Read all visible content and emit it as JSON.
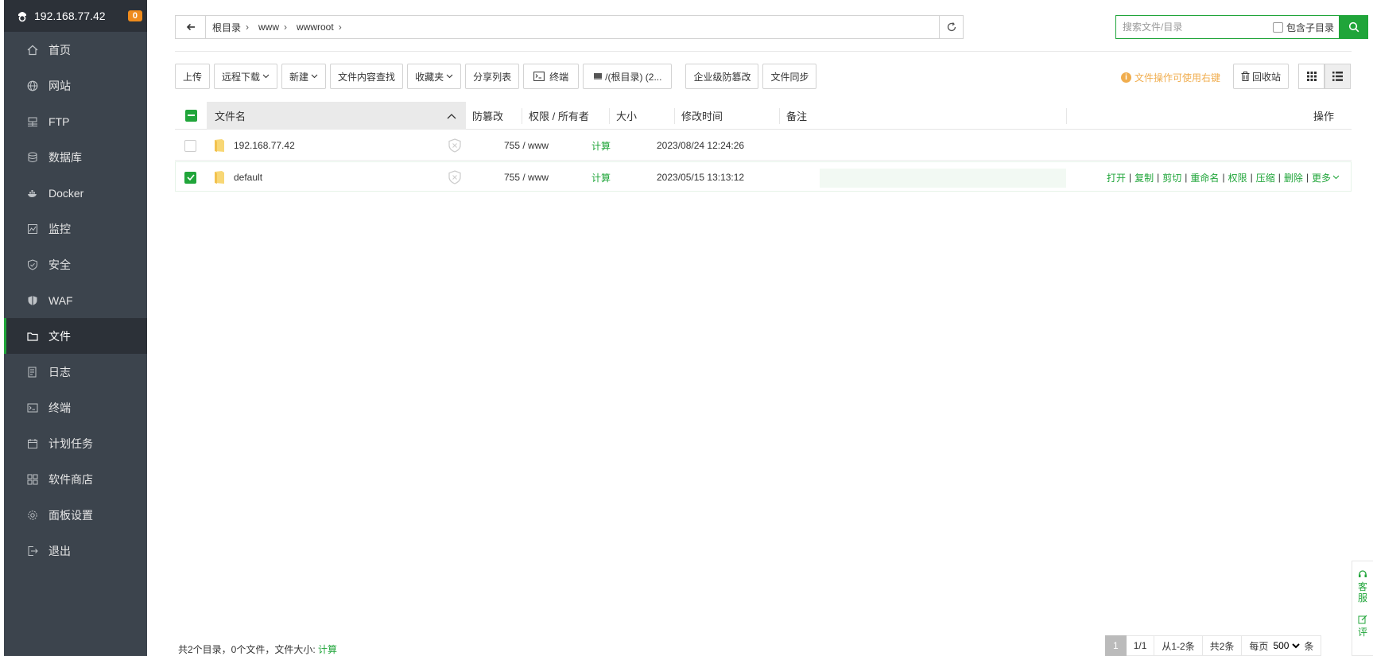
{
  "sidebar": {
    "host": "192.168.77.42",
    "badge": "0",
    "items": [
      {
        "label": "首页",
        "icon": "home-icon"
      },
      {
        "label": "网站",
        "icon": "globe-icon"
      },
      {
        "label": "FTP",
        "icon": "ftp-icon"
      },
      {
        "label": "数据库",
        "icon": "database-icon"
      },
      {
        "label": "Docker",
        "icon": "docker-icon"
      },
      {
        "label": "监控",
        "icon": "monitor-icon"
      },
      {
        "label": "安全",
        "icon": "shield-icon"
      },
      {
        "label": "WAF",
        "icon": "waf-icon"
      },
      {
        "label": "文件",
        "icon": "folder-icon"
      },
      {
        "label": "日志",
        "icon": "log-icon"
      },
      {
        "label": "终端",
        "icon": "terminal-icon"
      },
      {
        "label": "计划任务",
        "icon": "calendar-icon"
      },
      {
        "label": "软件商店",
        "icon": "apps-icon"
      },
      {
        "label": "面板设置",
        "icon": "gear-icon"
      },
      {
        "label": "退出",
        "icon": "logout-icon"
      }
    ],
    "active_index": 8
  },
  "path": {
    "crumbs": [
      "根目录",
      "www",
      "wwwroot"
    ]
  },
  "search": {
    "placeholder": "搜索文件/目录",
    "subdir_label": "包含子目录"
  },
  "toolbar": {
    "upload": "上传",
    "remote_download": "远程下载",
    "new": "新建",
    "content_search": "文件内容查找",
    "favorites": "收藏夹",
    "share_list": "分享列表",
    "terminal": "终端",
    "disk": "/(根目录) (2...",
    "tamper": "企业级防篡改",
    "sync": "文件同步",
    "tip": "文件操作可使用右键",
    "recycle": "回收站"
  },
  "table": {
    "headers": {
      "name": "文件名",
      "tamper": "防篡改",
      "perm": "权限 / 所有者",
      "size": "大小",
      "mtime": "修改时间",
      "note": "备注",
      "ops": "操作"
    },
    "rows": [
      {
        "name": "192.168.77.42",
        "perm": "755 / www",
        "size": "计算",
        "mtime": "2023/08/24 12:24:26",
        "checked": false
      },
      {
        "name": "default",
        "perm": "755 / www",
        "size": "计算",
        "mtime": "2023/05/15 13:13:12",
        "checked": true
      }
    ],
    "row_ops": [
      "打开",
      "复制",
      "剪切",
      "重命名",
      "权限",
      "压缩",
      "删除",
      "更多"
    ]
  },
  "footer": {
    "summary": "共2个目录，0个文件，文件大小:",
    "calc": "计算"
  },
  "pager": {
    "current": "1",
    "pages": "1/1",
    "range": "从1-2条",
    "total": "共2条",
    "per_page_label": "每页",
    "per_page": "500",
    "unit": "条"
  },
  "service": {
    "label1": "客",
    "label2": "服",
    "label3": "评"
  },
  "colors": {
    "accent": "#20a53a",
    "sidebar": "#3c444d",
    "warning": "#f0ad4e",
    "badge": "#ef8b1c"
  }
}
